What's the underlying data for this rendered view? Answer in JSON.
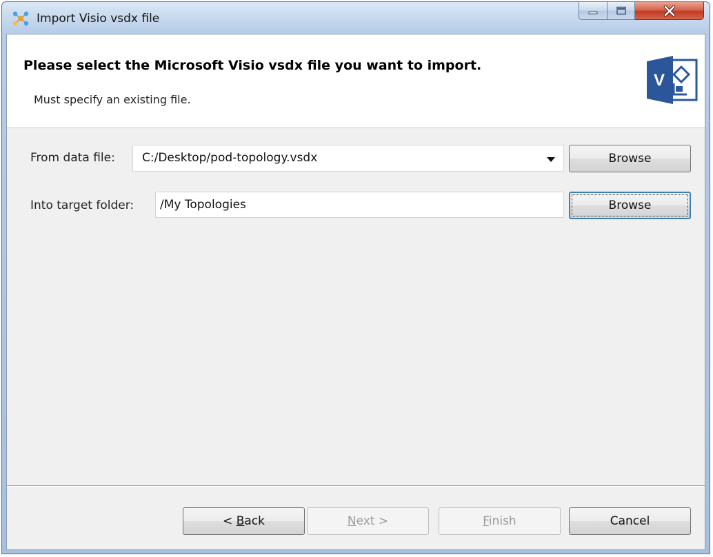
{
  "window": {
    "title": "Import Visio vsdx file",
    "app_icon": "network-nodes-icon"
  },
  "controls": {
    "minimize_icon": "minimize-icon",
    "maximize_icon": "maximize-icon",
    "close_icon": "close-icon"
  },
  "header": {
    "title": "Please select the Microsoft Visio vsdx file you want to import.",
    "description": "Must specify an existing file.",
    "logo_icon": "visio-logo-icon",
    "logo_letter": "V",
    "logo_color": "#2b579a"
  },
  "form": {
    "data_file": {
      "label": "From data file:",
      "value": "C:/Desktop/pod-topology.vsdx",
      "browse_label": "Browse"
    },
    "target_folder": {
      "label": "Into target folder:",
      "value": "/My Topologies",
      "browse_label": "Browse"
    }
  },
  "footer": {
    "back": {
      "mnemonic_prefix": "< ",
      "mnemonic": "B",
      "rest": "ack"
    },
    "next": {
      "mnemonic": "N",
      "rest": "ext >"
    },
    "finish": {
      "mnemonic": "F",
      "rest": "inish"
    },
    "cancel": "Cancel"
  }
}
